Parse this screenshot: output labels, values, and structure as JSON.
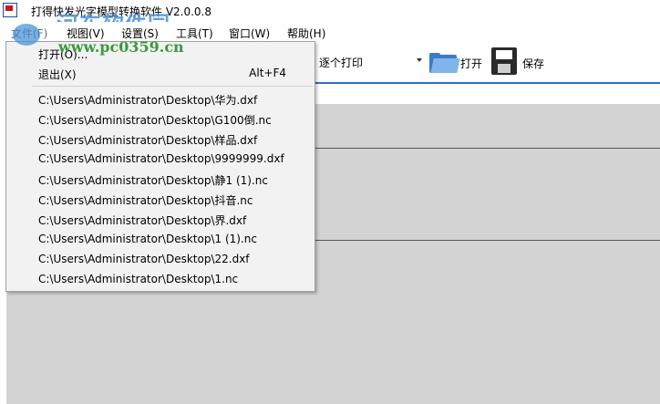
{
  "window": {
    "title": "打得快发光字模型转换软件 V2.0.0.8"
  },
  "watermark": {
    "text": "河东软件园",
    "url": "www.pc0359.cn"
  },
  "menubar": {
    "file": "文件(F)",
    "view": "视图(V)",
    "settings": "设置(S)",
    "tools": "工具(T)",
    "window": "窗口(W)",
    "help": "帮助(H)"
  },
  "toolbar": {
    "print_mode": "逐个打印",
    "open_label": "打开",
    "save_label": "保存"
  },
  "file_menu": {
    "open": "打开(O)...",
    "exit": "退出(X)",
    "exit_shortcut": "Alt+F4",
    "recent_files": [
      "C:\\Users\\Administrator\\Desktop\\华为.dxf",
      "C:\\Users\\Administrator\\Desktop\\G100倒.nc",
      "C:\\Users\\Administrator\\Desktop\\样品.dxf",
      "C:\\Users\\Administrator\\Desktop\\9999999.dxf",
      "C:\\Users\\Administrator\\Desktop\\静1 (1).nc",
      "C:\\Users\\Administrator\\Desktop\\抖音.nc",
      "C:\\Users\\Administrator\\Desktop\\界.dxf",
      "C:\\Users\\Administrator\\Desktop\\1 (1).nc",
      "C:\\Users\\Administrator\\Desktop\\22.dxf",
      "C:\\Users\\Administrator\\Desktop\\1.nc"
    ]
  },
  "colors": {
    "accent": "#2b6fc9",
    "workspace": "#d3d3d3",
    "menu_bg": "#f2f2f2"
  }
}
